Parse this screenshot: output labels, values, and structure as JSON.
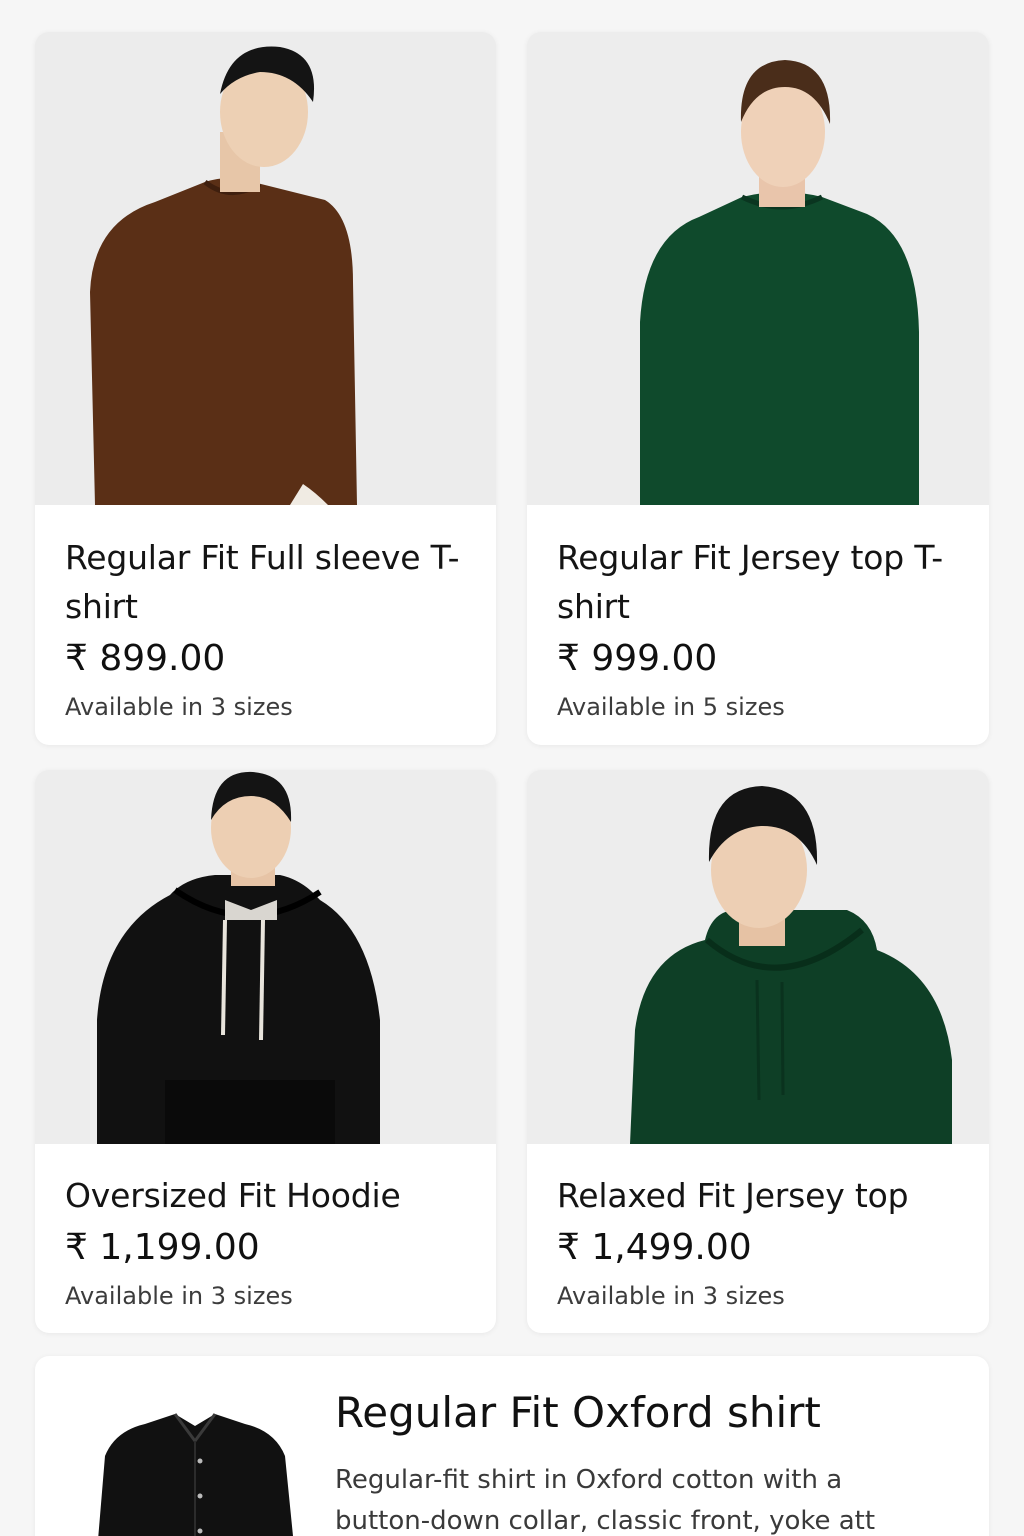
{
  "currency_symbol": "₹",
  "products": [
    {
      "title": "Regular Fit Full sleeve T-shirt",
      "price": "₹ 899.00",
      "availability": "Available in 3 sizes",
      "image": "man-in-brown-sweatshirt",
      "garment_color": "#5a2f16"
    },
    {
      "title": "Regular Fit Jersey top T-shirt",
      "price": "₹ 999.00",
      "availability": "Available in 5 sizes",
      "image": "man-in-green-sweatshirt",
      "garment_color": "#0f4a2c"
    },
    {
      "title": "Oversized Fit Hoodie",
      "price": "₹ 1,199.00",
      "availability": "Available in 3 sizes",
      "image": "man-in-black-hoodie",
      "garment_color": "#111111"
    },
    {
      "title": "Relaxed Fit Jersey top",
      "price": "₹ 1,499.00",
      "availability": "Available in 3 sizes",
      "image": "man-in-green-hoodie",
      "garment_color": "#0e3f26"
    }
  ],
  "featured": {
    "title": "Regular Fit Oxford shirt",
    "description": "Regular-fit shirt in Oxford cotton with a button-down collar, classic front, yoke att back",
    "image": "black-oxford-shirt",
    "garment_color": "#111111"
  }
}
